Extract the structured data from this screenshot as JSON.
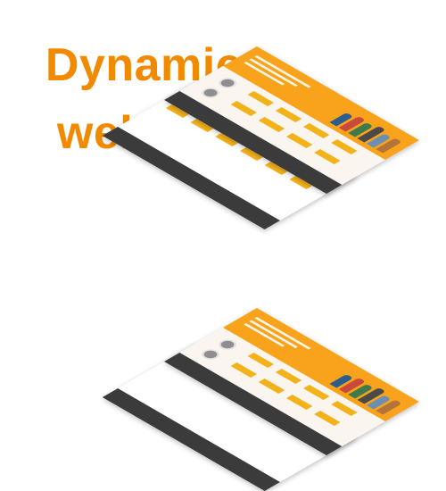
{
  "title": {
    "line1": "Dynamic",
    "line2": "website"
  },
  "colors": {
    "accent": "#f28a00",
    "hero": "#f8a31b",
    "card": "#f4b21a",
    "footer": "#3b3b3b"
  }
}
